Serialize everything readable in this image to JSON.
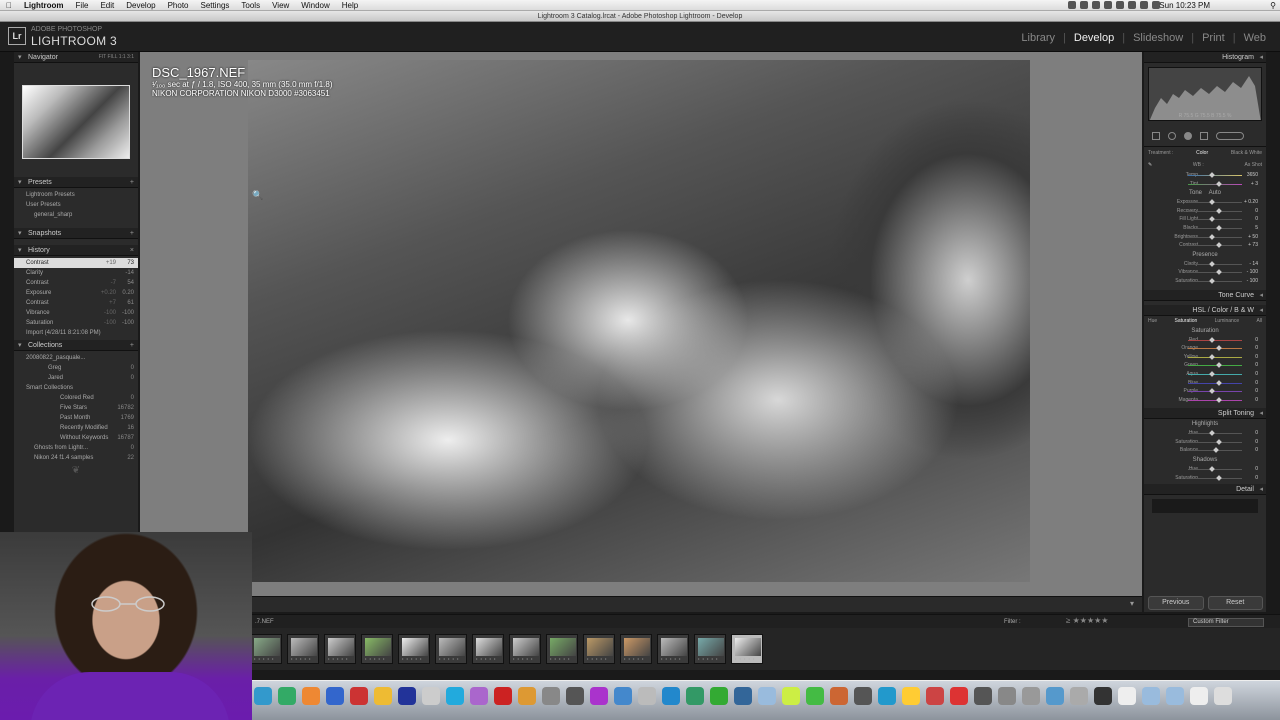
{
  "menubar": {
    "app": "Lightroom",
    "items": [
      "File",
      "Edit",
      "Develop",
      "Photo",
      "Settings",
      "Tools",
      "View",
      "Window",
      "Help"
    ],
    "clock": "Sun 10:23 PM"
  },
  "window": {
    "title": "Lightroom 3 Catalog.lrcat - Adobe Photoshop Lightroom - Develop"
  },
  "header": {
    "logo": "Lr",
    "brand_small": "ADOBE PHOTOSHOP",
    "brand": "LIGHTROOM 3",
    "modules": [
      "Library",
      "Develop",
      "Slideshow",
      "Print",
      "Web"
    ],
    "active_module": "Develop"
  },
  "left": {
    "navigator": {
      "title": "Navigator",
      "opts": "FIT  FILL  1:1  3:1"
    },
    "presets": {
      "title": "Presets",
      "items": [
        "Lightroom Presets",
        "User Presets",
        "general_sharp"
      ]
    },
    "snapshots": {
      "title": "Snapshots"
    },
    "history": {
      "title": "History",
      "items": [
        {
          "label": "Contrast",
          "v1": "+19",
          "v2": "73"
        },
        {
          "label": "Clarity",
          "v1": "",
          "v2": "-14"
        },
        {
          "label": "Contrast",
          "v1": "-7",
          "v2": "54"
        },
        {
          "label": "Exposure",
          "v1": "+0.20",
          "v2": "0.20"
        },
        {
          "label": "Contrast",
          "v1": "+7",
          "v2": "61"
        },
        {
          "label": "Vibrance",
          "v1": "-100",
          "v2": "-100"
        },
        {
          "label": "Saturation",
          "v1": "-100",
          "v2": "-100"
        },
        {
          "label": "Import (4/28/11 8:21:08 PM)",
          "v1": "",
          "v2": ""
        }
      ]
    },
    "collections": {
      "title": "Collections",
      "items": [
        {
          "label": "20080822_pasquale...",
          "count": ""
        },
        {
          "label": "Greg",
          "count": "0"
        },
        {
          "label": "Jared",
          "count": "0"
        },
        {
          "label": "Smart Collections",
          "count": ""
        },
        {
          "label": "Colored Red",
          "count": "0"
        },
        {
          "label": "Five Stars",
          "count": "16782"
        },
        {
          "label": "Past Month",
          "count": "1769"
        },
        {
          "label": "Recently Modified",
          "count": "16"
        },
        {
          "label": "Without Keywords",
          "count": "16787"
        },
        {
          "label": "Ghosts from Lightr...",
          "count": "0"
        },
        {
          "label": "Nikon 24 f1.4 samples",
          "count": "22"
        }
      ]
    }
  },
  "photo": {
    "filename": "DSC_1967.NEF",
    "exposure": "¹⁄₁₀₀ sec at ƒ / 1.8, ISO 400, 35 mm (35.0 mm f/1.8)",
    "camera": "NIKON CORPORATION NIKON D3000 #3063451"
  },
  "right": {
    "histogram": {
      "title": "Histogram",
      "rgb": "R  75.5   G  75.5   B  75.5  %"
    },
    "treatment": {
      "label": "Treatment :",
      "color": "Color",
      "bw": "Black & White"
    },
    "wb": {
      "label": "WB :",
      "value": "As Shot"
    },
    "basic": [
      {
        "label": "Temp",
        "val": "3650"
      },
      {
        "label": "Tint",
        "val": "+ 3"
      }
    ],
    "tone_label": "Tone",
    "auto": "Auto",
    "tone": [
      {
        "label": "Exposure",
        "val": "+ 0.20"
      },
      {
        "label": "Recovery",
        "val": "0"
      },
      {
        "label": "Fill Light",
        "val": "0"
      },
      {
        "label": "Blacks",
        "val": "5"
      },
      {
        "label": "Brightness",
        "val": "+ 50"
      },
      {
        "label": "Contrast",
        "val": "+ 73"
      }
    ],
    "presence_label": "Presence",
    "presence": [
      {
        "label": "Clarity",
        "val": "- 14"
      },
      {
        "label": "Vibrance",
        "val": "- 100"
      },
      {
        "label": "Saturation",
        "val": "- 100"
      }
    ],
    "tonecurve": "Tone Curve",
    "hsl": {
      "title": "HSL  /  Color  /  B & W",
      "tabs": [
        "Hue",
        "Saturation",
        "Luminance",
        "All"
      ],
      "sub": "Saturation",
      "rows": [
        {
          "label": "Red",
          "val": "0"
        },
        {
          "label": "Orange",
          "val": "0"
        },
        {
          "label": "Yellow",
          "val": "0"
        },
        {
          "label": "Green",
          "val": "0"
        },
        {
          "label": "Aqua",
          "val": "0"
        },
        {
          "label": "Blue",
          "val": "0"
        },
        {
          "label": "Purple",
          "val": "0"
        },
        {
          "label": "Magenta",
          "val": "0"
        }
      ]
    },
    "split": {
      "title": "Split Toning",
      "hl": "Highlights",
      "sh": "Shadows",
      "rows1": [
        {
          "label": "Hue",
          "val": "0"
        },
        {
          "label": "Saturation",
          "val": "0"
        }
      ],
      "bal": {
        "label": "Balance",
        "val": "0"
      },
      "rows2": [
        {
          "label": "Hue",
          "val": "0"
        },
        {
          "label": "Saturation",
          "val": "0"
        }
      ]
    },
    "detail": "Detail",
    "previous": "Previous",
    "reset": "Reset"
  },
  "filmstrip": {
    "current": ".7.NEF",
    "filter_label": "Filter :",
    "stars": "≥ ★★★★★",
    "custom_filter": "Custom Filter"
  }
}
